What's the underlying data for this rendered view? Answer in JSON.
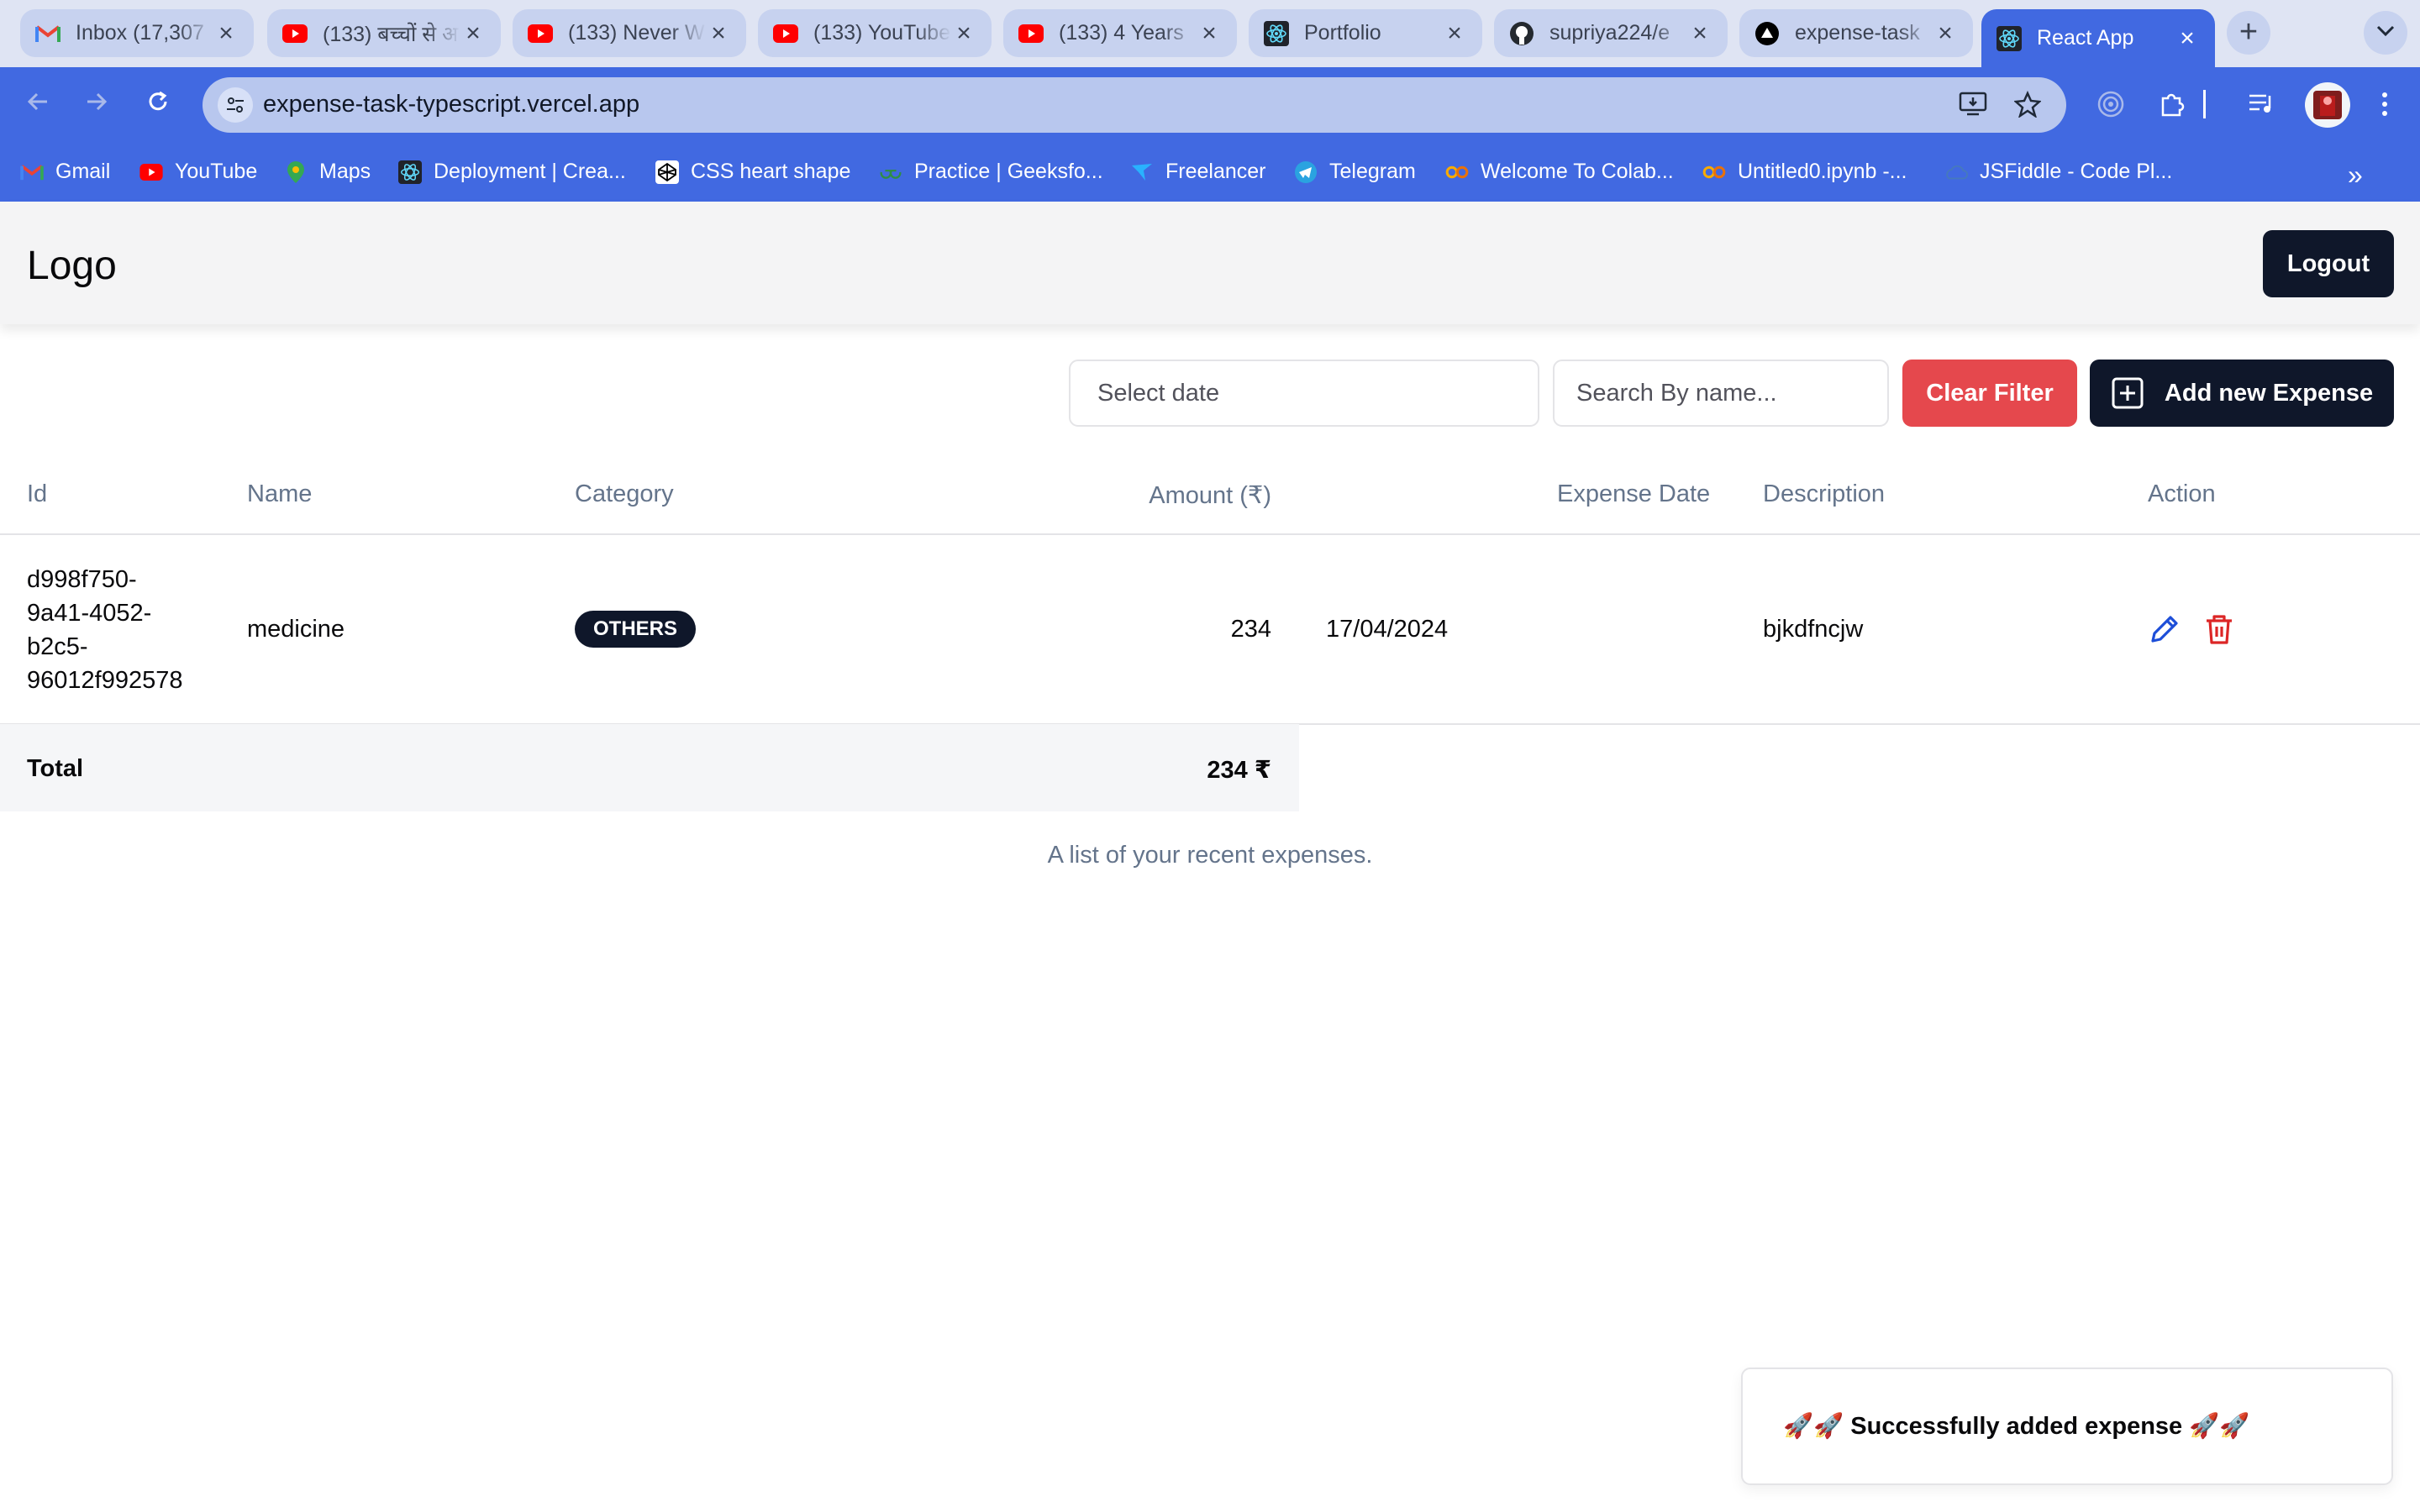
{
  "browser": {
    "tabs": [
      {
        "title": "Inbox (17,307",
        "icon": "gmail-icon"
      },
      {
        "title": "(133) बच्चों से अ",
        "icon": "youtube-icon"
      },
      {
        "title": "(133) Never W",
        "icon": "youtube-icon"
      },
      {
        "title": "(133) YouTube",
        "icon": "youtube-icon"
      },
      {
        "title": "(133) 4 Years",
        "icon": "youtube-icon"
      },
      {
        "title": "Portfolio",
        "icon": "react-icon"
      },
      {
        "title": "supriya224/e",
        "icon": "github-icon"
      },
      {
        "title": "expense-task",
        "icon": "vercel-icon"
      },
      {
        "title": "React App",
        "icon": "react-icon"
      }
    ],
    "new_tab": "+",
    "tab_close": "×",
    "url": "expense-task-typescript.vercel.app",
    "bookmarks": [
      {
        "label": "Gmail",
        "icon": "gmail-icon"
      },
      {
        "label": "YouTube",
        "icon": "youtube-icon"
      },
      {
        "label": "Maps",
        "icon": "maps-icon"
      },
      {
        "label": "Deployment | Crea...",
        "icon": "react-icon"
      },
      {
        "label": "CSS heart shape",
        "icon": "codepen-icon"
      },
      {
        "label": "Practice | Geeksfo...",
        "icon": "geeksforgeeks-icon"
      },
      {
        "label": "Freelancer",
        "icon": "freelancer-icon"
      },
      {
        "label": "Telegram",
        "icon": "telegram-icon"
      },
      {
        "label": "Welcome To Colab...",
        "icon": "colab-icon"
      },
      {
        "label": "Untitled0.ipynb -...",
        "icon": "colab-icon"
      },
      {
        "label": "JSFiddle - Code Pl...",
        "icon": "jsfiddle-icon"
      }
    ],
    "bookmarks_overflow": "»"
  },
  "header": {
    "logo": "Logo",
    "logout_label": "Logout"
  },
  "filters": {
    "date_placeholder": "Select date",
    "search_placeholder": "Search By name...",
    "clear_label": "Clear Filter",
    "add_label": "Add new Expense"
  },
  "table": {
    "columns": [
      "Id",
      "Name",
      "Category",
      "Amount (₹)",
      "Expense Date",
      "Description",
      "Action"
    ],
    "rows": [
      {
        "id_lines": [
          "d998f750-",
          "9a41-4052-",
          "b2c5-",
          "96012f992578"
        ],
        "name": "medicine",
        "category": "OTHERS",
        "amount": "234",
        "date": "17/04/2024",
        "description": "bjkdfncjw"
      }
    ],
    "total_label": "Total",
    "total_value": "234 ₹",
    "caption": "A list of your recent expenses."
  },
  "toast": {
    "message": "🚀🚀 Successfully added expense 🚀🚀"
  },
  "colors": {
    "browser_accent": "#4169e1",
    "primary": "#0f172a",
    "danger": "#e5484d",
    "edit_icon": "#1d4ed8",
    "delete_icon": "#dc2626"
  }
}
